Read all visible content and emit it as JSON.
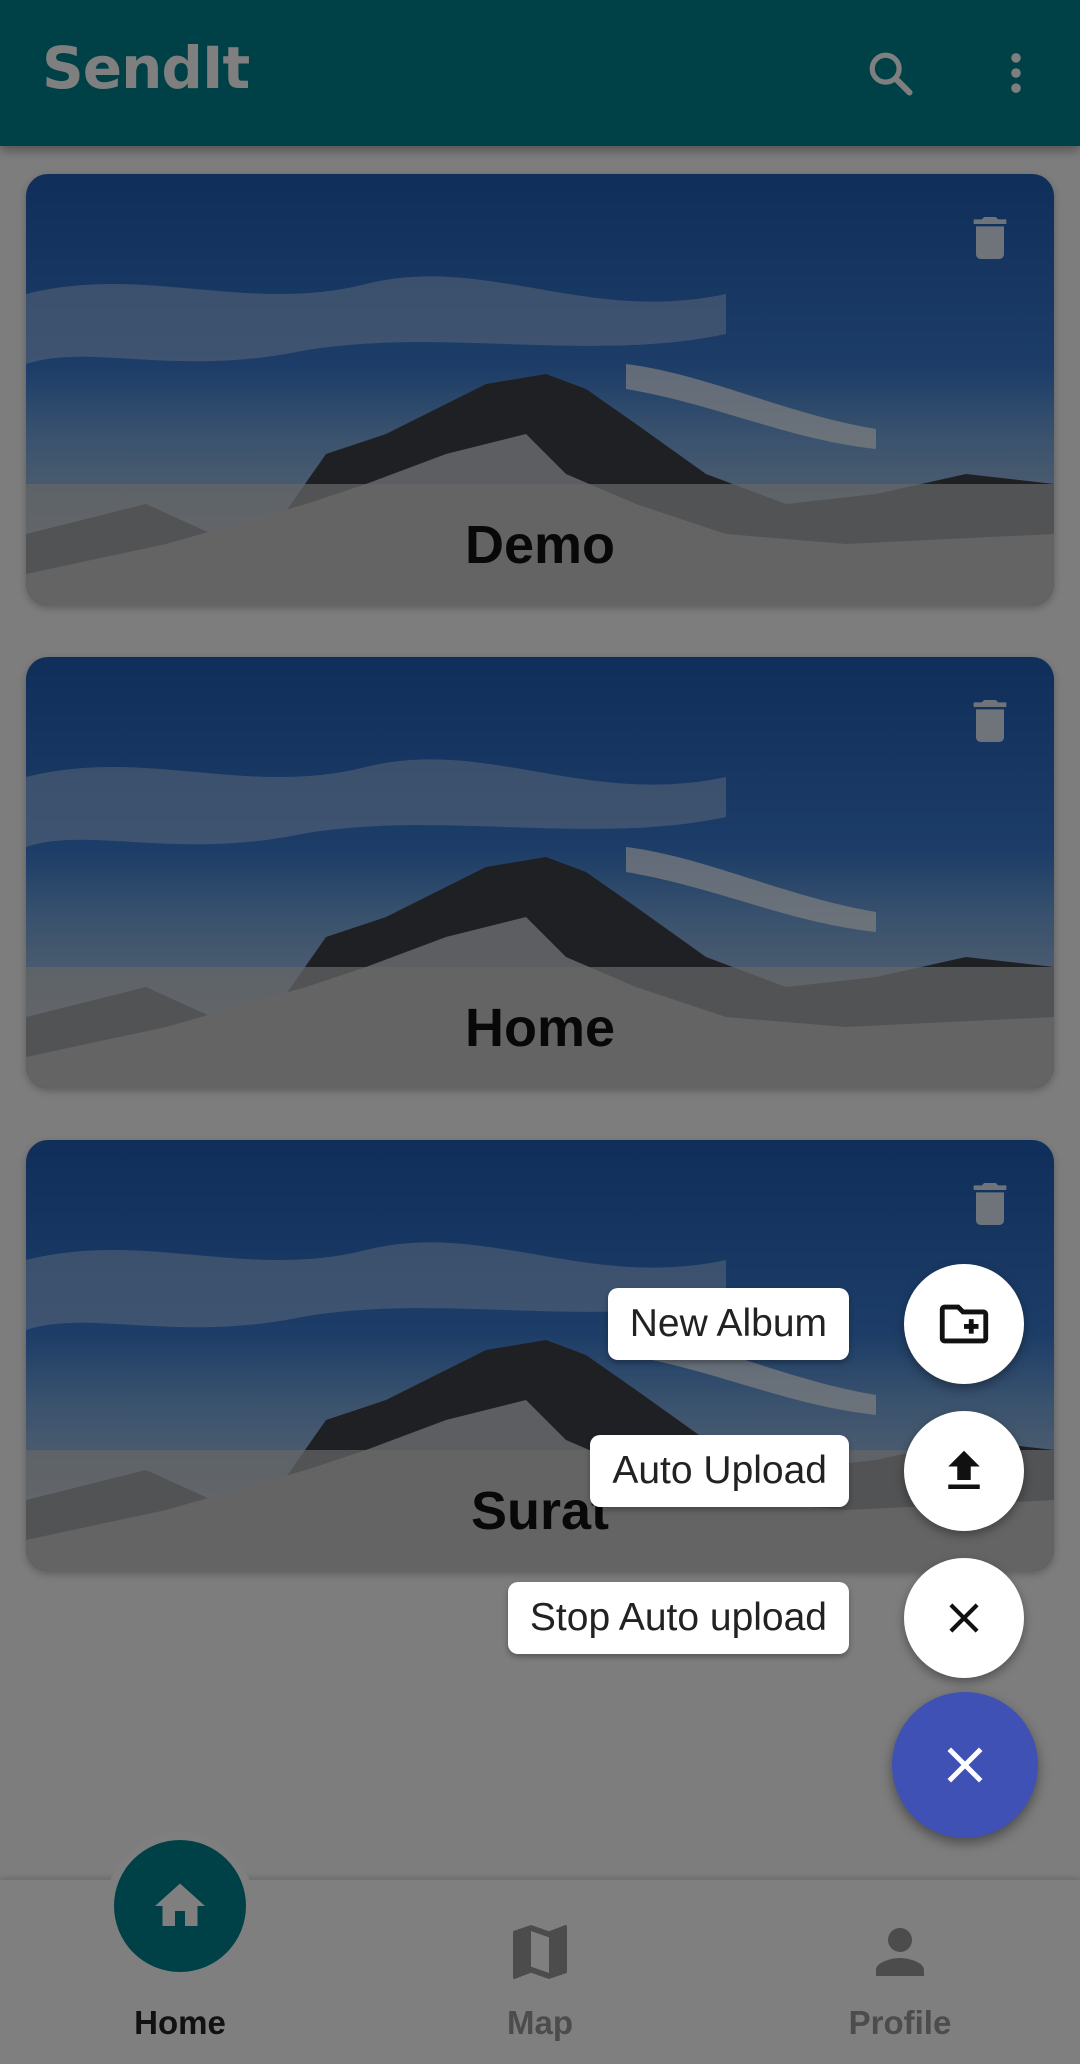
{
  "app": {
    "title": "SendIt"
  },
  "appbar": {
    "search_icon": "search-icon",
    "menu_icon": "more-vert-icon"
  },
  "albums": [
    {
      "title": "Demo",
      "delete_icon": "trash-icon"
    },
    {
      "title": "Home",
      "delete_icon": "trash-icon"
    },
    {
      "title": "Surat",
      "delete_icon": "trash-icon"
    }
  ],
  "speed_dial": {
    "actions": [
      {
        "label": "New Album",
        "icon": "create-folder-icon"
      },
      {
        "label": "Auto Upload",
        "icon": "upload-icon"
      },
      {
        "label": "Stop Auto upload",
        "icon": "close-icon"
      }
    ],
    "main_icon": "close-icon"
  },
  "bottom_nav": {
    "items": [
      {
        "label": "Home",
        "icon": "home-icon",
        "active": true
      },
      {
        "label": "Map",
        "icon": "map-icon",
        "active": false
      },
      {
        "label": "Profile",
        "icon": "person-icon",
        "active": false
      }
    ]
  },
  "colors": {
    "app_bar": "#00838f",
    "fab": "#3f51b5",
    "scrim": "rgba(0,0,0,0.5)"
  }
}
